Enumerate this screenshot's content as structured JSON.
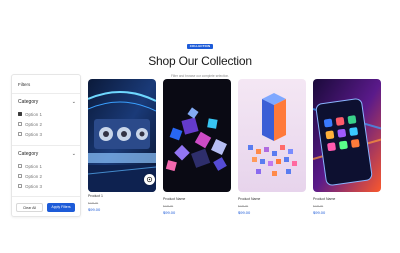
{
  "header": {
    "badge": "COLLECTION",
    "title": "Shop Our Collection",
    "subtitle": "Filter and browse our complete selection."
  },
  "filters": {
    "title": "Filters",
    "groups": [
      {
        "label": "Category",
        "options": [
          {
            "label": "Option 1",
            "checked": true
          },
          {
            "label": "Option 2",
            "checked": false
          },
          {
            "label": "Option 3",
            "checked": false
          }
        ]
      },
      {
        "label": "Category",
        "options": [
          {
            "label": "Option 1",
            "checked": false
          },
          {
            "label": "Option 2",
            "checked": false
          },
          {
            "label": "Option 3",
            "checked": false
          }
        ]
      }
    ],
    "clear_label": "Clear All",
    "apply_label": "Apply Filters"
  },
  "products": [
    {
      "name": "Product 1",
      "old_price": "$129.00",
      "price": "$99.00",
      "image": "tech-robotics-lab"
    },
    {
      "name": "Product Name",
      "old_price": "$129.00",
      "price": "$99.00",
      "image": "abstract-3d-cubes"
    },
    {
      "name": "Product Name",
      "old_price": "$129.00",
      "price": "$99.00",
      "image": "isometric-data-blocks"
    },
    {
      "name": "Product Name",
      "old_price": "$129.00",
      "price": "$99.00",
      "image": "next-gen-apps-phone"
    }
  ],
  "colors": {
    "accent": "#1d5bd8",
    "text": "#1a1a1a",
    "muted": "#8a8a8a"
  }
}
